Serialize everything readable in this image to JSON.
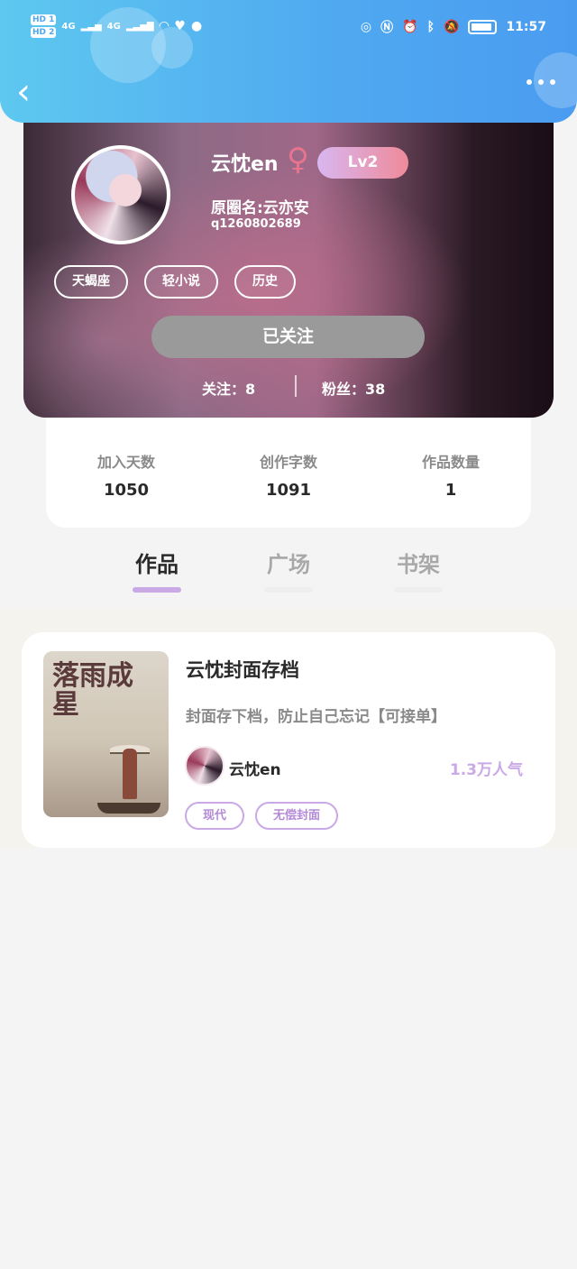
{
  "status_bar": {
    "hd1": "HD 1",
    "hd2": "HD 2",
    "net1": "4G",
    "net2": "4G",
    "time": "11:57"
  },
  "header": {
    "back_icon": "chevron-left-icon",
    "more_icon": "more-dots-icon"
  },
  "profile": {
    "username": "云忱en",
    "gender_symbol": "♀",
    "level": "Lv2",
    "original_name": "原圈名:云亦安",
    "qq": "q1260802689",
    "tags": [
      "天蝎座",
      "轻小说",
      "历史"
    ],
    "follow_button": "已关注",
    "following_label": "关注：8",
    "fans_label": "粉丝：38"
  },
  "stats": [
    {
      "label": "加入天数",
      "value": "1050"
    },
    {
      "label": "创作字数",
      "value": "1091"
    },
    {
      "label": "作品数量",
      "value": "1"
    }
  ],
  "tabs": [
    {
      "label": "作品",
      "active": true
    },
    {
      "label": "广场",
      "active": false
    },
    {
      "label": "书架",
      "active": false
    }
  ],
  "work": {
    "cover_text": "落雨成星",
    "title": "云忱封面存档",
    "description": "封面存下档，防止自己忘记【可接单】",
    "author": "云忱en",
    "popularity": "1.3万人气",
    "tags": [
      "现代",
      "无偿封面"
    ]
  },
  "colors": {
    "header_start": "#5ec8f0",
    "header_end": "#4a9cf0",
    "accent_purple": "#c9a9e6",
    "level_gradient_start": "#d8b7f0",
    "level_gradient_end": "#ef8a9a",
    "female": "#e7748d"
  }
}
